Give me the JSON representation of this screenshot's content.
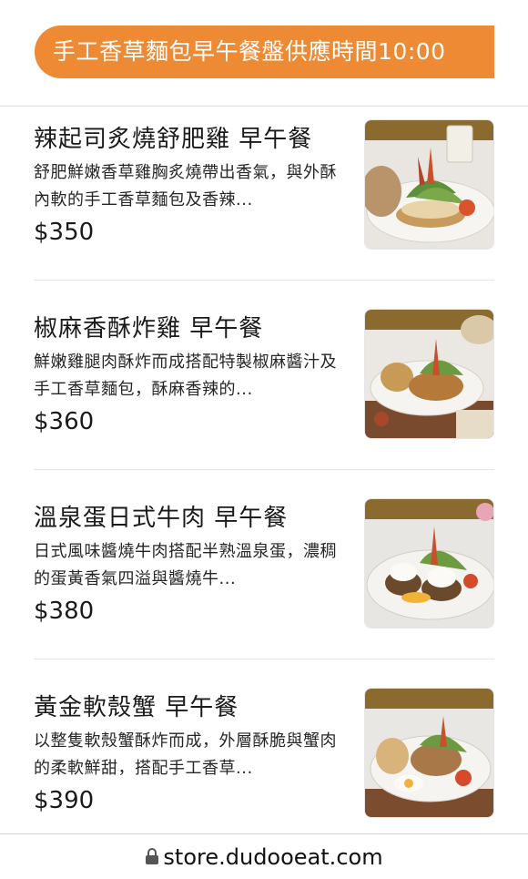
{
  "banner": {
    "text": "手工香草麵包早午餐盤供應時間10:00",
    "color": "#ee8a33"
  },
  "items": [
    {
      "name": "辣起司炙燒舒肥雞 早午餐",
      "description": "舒肥鮮嫩香草雞胸炙燒帶出香氣，與外酥內軟的手工香草麵包及香辣...",
      "price": "$350",
      "image": "brunch-plate-chicken-photo"
    },
    {
      "name": "椒麻香酥炸雞 早午餐",
      "description": "鮮嫩雞腿肉酥炸而成搭配特製椒麻醬汁及手工香草麵包，酥麻香辣的...",
      "price": "$360",
      "image": "brunch-plate-fried-chicken-photo"
    },
    {
      "name": "溫泉蛋日式牛肉 早午餐",
      "description": "日式風味醬燒牛肉搭配半熟溫泉蛋，濃稠的蛋黃香氣四溢與醬燒牛...",
      "price": "$380",
      "image": "brunch-plate-beef-egg-photo"
    },
    {
      "name": "黃金軟殼蟹 早午餐",
      "description": "以整隻軟殼蟹酥炸而成，外層酥脆與蟹肉的柔軟鮮甜，搭配手工香草...",
      "price": "$390",
      "image": "brunch-plate-crab-photo"
    }
  ],
  "footer": {
    "url": "store.dudooeat.com",
    "icon": "lock-icon"
  }
}
